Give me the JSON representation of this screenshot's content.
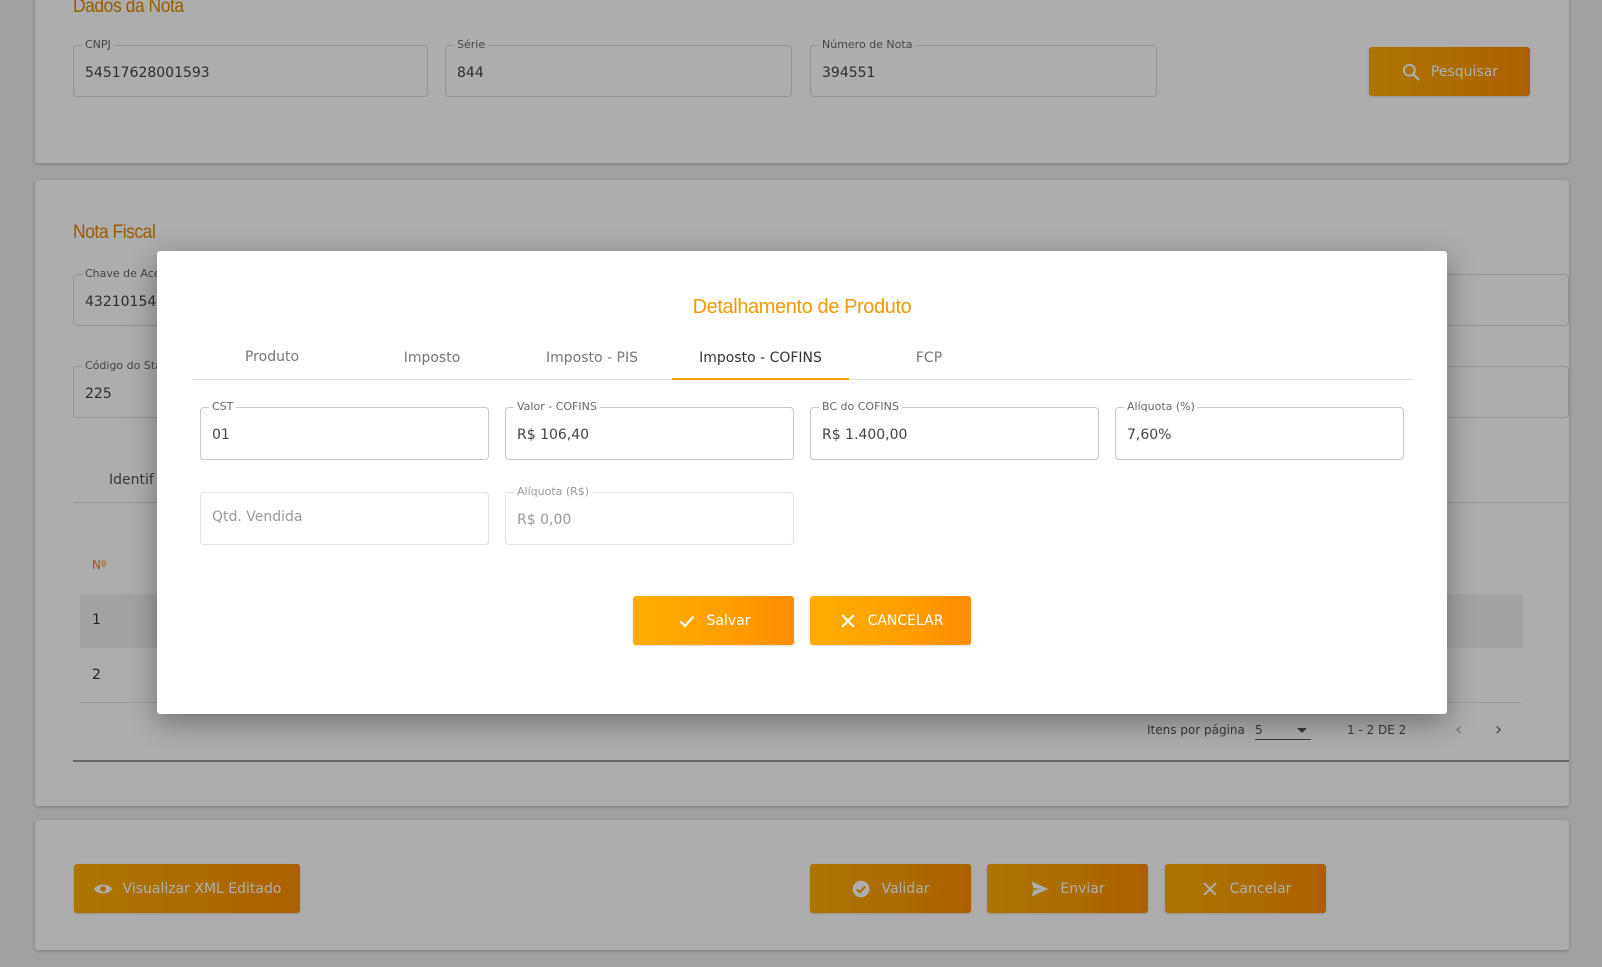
{
  "dados_nota": {
    "title": "Dados da Nota",
    "cnpj_label": "CNPJ",
    "cnpj_value": "54517628001593",
    "serie_label": "Série",
    "serie_value": "844",
    "numero_label": "Número de Nota",
    "numero_value": "394551",
    "pesquisar_label": "Pesquisar"
  },
  "nota_fiscal": {
    "title": "Nota Fiscal",
    "chave_label": "Chave de Ace",
    "chave_value": "43210154",
    "codigo_label": "Código do Sta",
    "codigo_value": "225",
    "tab_partial": "Identif",
    "table_header_num": "Nº",
    "rows": [
      "1",
      "2"
    ],
    "pager_label": "Itens por página",
    "pager_size": "5",
    "pager_range": "1 - 2 DE 2"
  },
  "footer": {
    "visualizar_label": "Visualizar XML Editado",
    "validar_label": "Validar",
    "enviar_label": "Enviar",
    "cancelar_label": "Cancelar"
  },
  "modal": {
    "title": "Detalhamento de Produto",
    "tabs": [
      "Produto",
      "Imposto",
      "Imposto - PIS",
      "Imposto - COFINS",
      "FCP"
    ],
    "active_tab": "Imposto - COFINS",
    "fields": {
      "cst_label": "CST",
      "cst_value": "01",
      "valor_label": "Valor - COFINS",
      "valor_value": "R$ 106,40",
      "bc_label": "BC do COFINS",
      "bc_value": "R$ 1.400,00",
      "aliquota_pct_label": "Alíquota (%)",
      "aliquota_pct_value": "7,60%",
      "qtd_placeholder": "Qtd. Vendida",
      "aliquota_rs_label": "Alíquota (R$)",
      "aliquota_rs_value": "R$ 0,00"
    },
    "salvar_label": "Salvar",
    "cancelar_label": "CANCELAR"
  },
  "colors": {
    "accent": "#ffa000",
    "title_orange": "#e08a00"
  }
}
